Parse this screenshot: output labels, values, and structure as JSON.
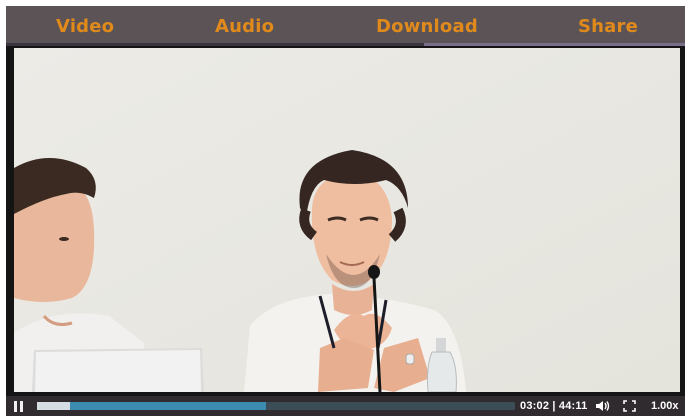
{
  "tabs": {
    "video": "Video",
    "audio": "Audio",
    "download": "Download",
    "share": "Share"
  },
  "player": {
    "progress_played_fraction": 0.07,
    "progress_buffered_fraction": 0.48,
    "current_time": "03:02",
    "separator": "|",
    "total_time": "44:11",
    "time_display": "03:02 | 44:11",
    "playback_speed": "1.00x",
    "state": "playing"
  },
  "icons": {
    "pause": "pause-icon",
    "volume": "volume-icon",
    "fullscreen": "fullscreen-icon"
  },
  "colors": {
    "tab_text": "#e18a1c",
    "tab_bar": "#5b5356",
    "control_bar": "#2f2b2e",
    "seek_buffer": "#3c8bb1"
  }
}
